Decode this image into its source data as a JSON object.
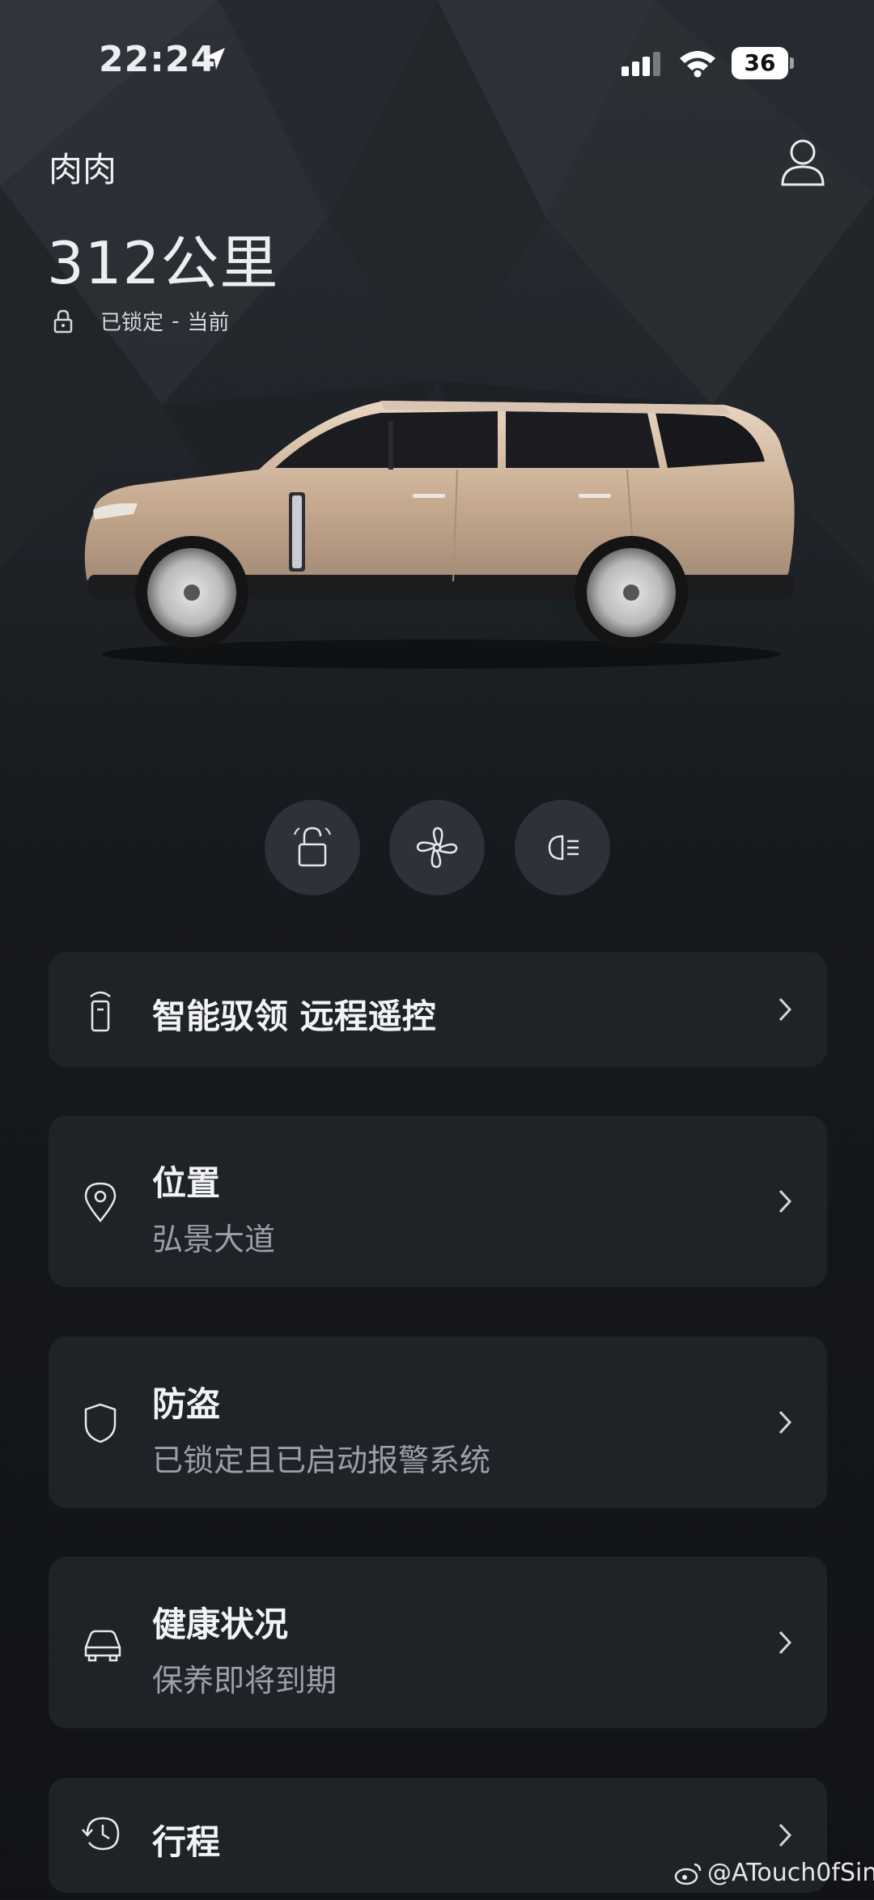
{
  "status_bar": {
    "time": "22:24",
    "battery": "36"
  },
  "vehicle": {
    "name": "肉肉",
    "range": "312公里",
    "lock_status": "已锁定",
    "separator": "-",
    "lock_time": "当前"
  },
  "quick_actions": [
    {
      "icon": "unlock-icon"
    },
    {
      "icon": "fan-icon"
    },
    {
      "icon": "headlight-icon"
    }
  ],
  "cards": [
    {
      "icon": "key-fob-icon",
      "title": "智能驭领 远程遥控"
    },
    {
      "icon": "location-pin-icon",
      "title": "位置",
      "subtitle": "弘景大道"
    },
    {
      "icon": "shield-icon",
      "title": "防盗",
      "subtitle": "已锁定且已启动报警系统"
    },
    {
      "icon": "car-icon",
      "title": "健康状况",
      "subtitle": "保养即将到期"
    },
    {
      "icon": "history-icon",
      "title": "行程"
    }
  ],
  "watermark": "@ATouch0fSin"
}
